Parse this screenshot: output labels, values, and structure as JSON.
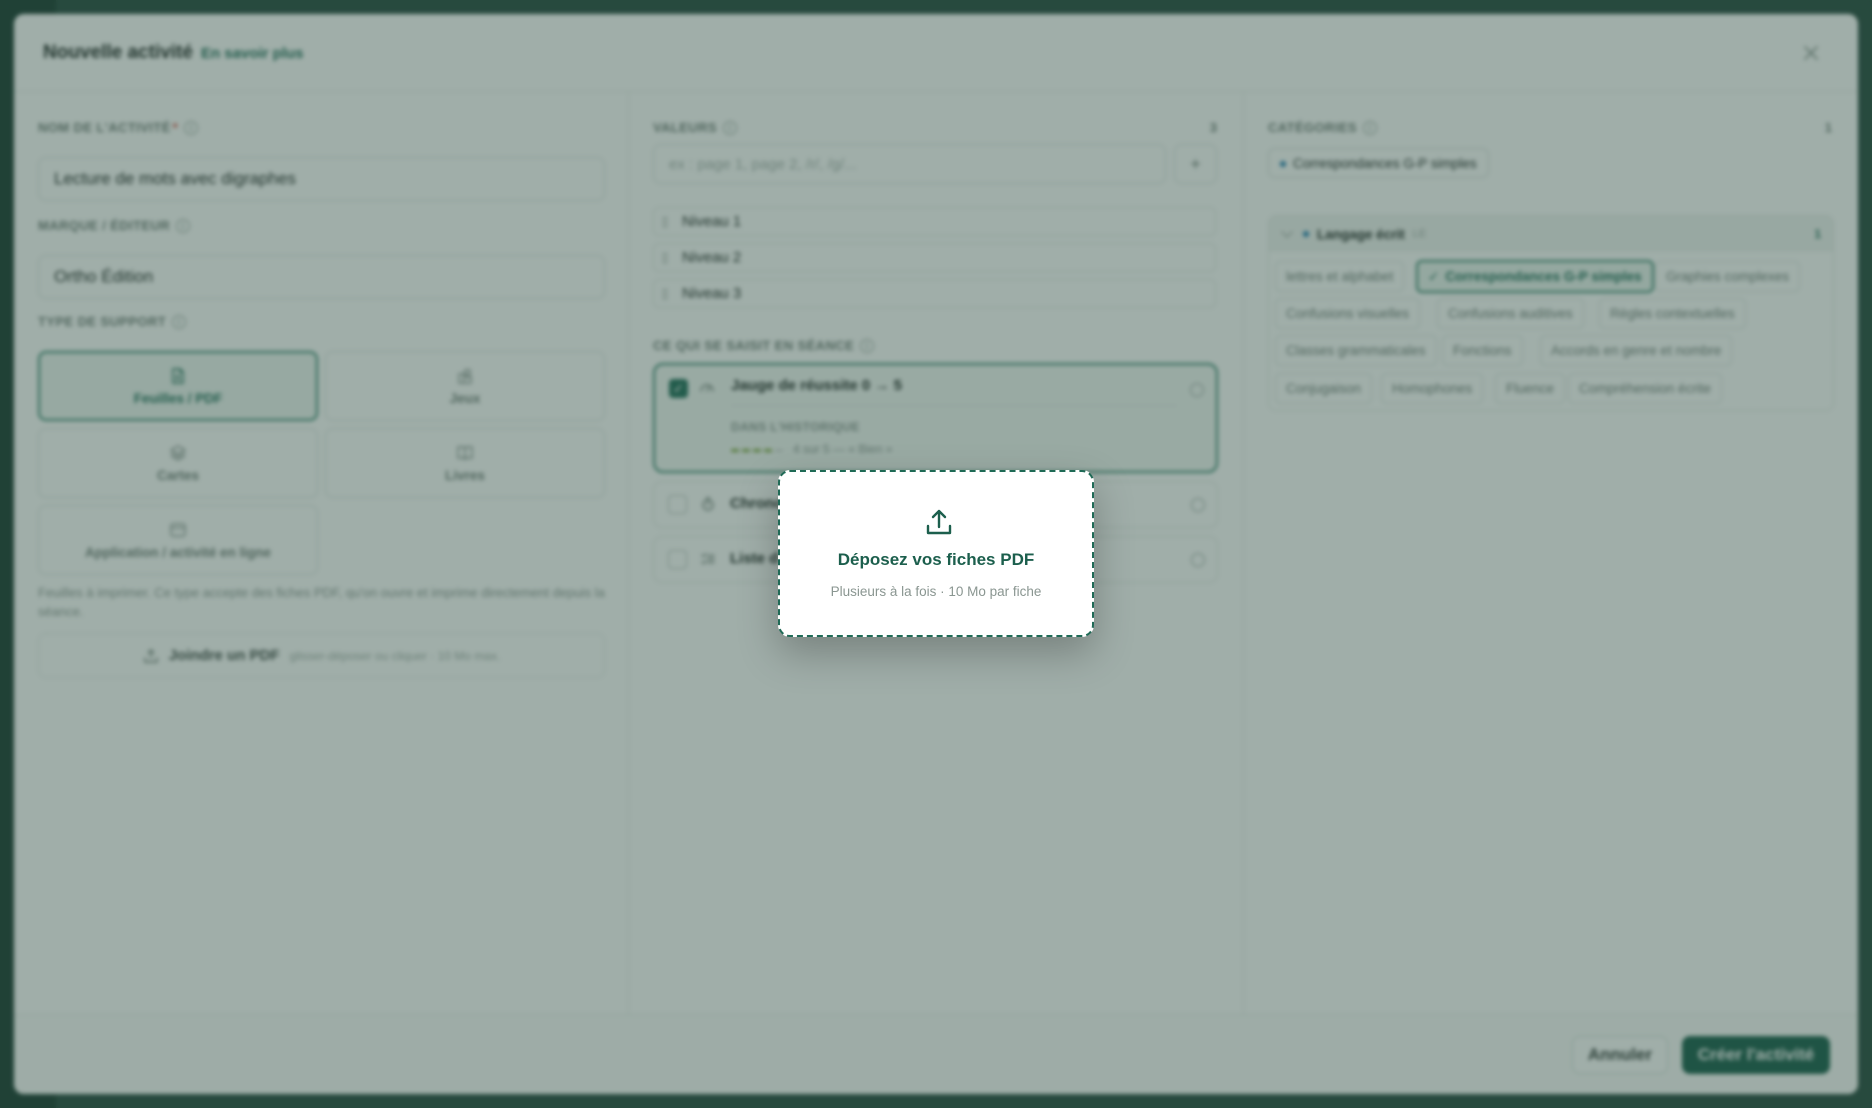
{
  "header": {
    "title": "Nouvelle activité",
    "learn_more": "En savoir plus"
  },
  "left": {
    "name_label": "NOM DE L'ACTIVITÉ",
    "name_required": "*",
    "name_value": "Lecture de mots avec digraphes",
    "brand_label": "MARQUE / ÉDITEUR",
    "brand_value": "Ortho Édition",
    "support_label": "TYPE DE SUPPORT",
    "supports": [
      {
        "label": "Feuilles / PDF",
        "icon": "file-icon",
        "active": true
      },
      {
        "label": "Jeux",
        "icon": "puzzle-icon",
        "active": false
      },
      {
        "label": "Cartes",
        "icon": "layers-icon",
        "active": false
      },
      {
        "label": "Livres",
        "icon": "book-icon",
        "active": false
      },
      {
        "label": "Application / activité en ligne",
        "icon": "browser-icon",
        "active": false
      }
    ],
    "description": "Feuilles à imprimer. Ce type accepte des fiches PDF, qu'on ouvre et imprime directement depuis la séance.",
    "join_pdf": "Joindre un PDF",
    "join_pdf_hint": "glisser-déposer ou cliquer · 10 Mo max."
  },
  "middle": {
    "values_label": "VALEURS",
    "values_count": "3",
    "values_placeholder": "ex : page 1, page 2, /r/, /g/...",
    "add_label": "+",
    "levels": [
      "Niveau 1",
      "Niveau 2",
      "Niveau 3"
    ],
    "session_label": "CE QUI SE SAISIT EN SÉANCE",
    "gauge": {
      "title": "Jauge de réussite 0 → 5",
      "history_label": "DANS L'HISTORIQUE",
      "history_value": "4 sur 5 — « Bien »",
      "level": 4,
      "max": 5
    },
    "options": [
      {
        "title": "Chrono",
        "icon": "stopwatch-icon"
      },
      {
        "title": "Liste d",
        "icon": "list-icon"
      }
    ]
  },
  "right": {
    "categories_label": "CATÉGORIES",
    "categories_count": "1",
    "selected": "Correspondances G-P simples",
    "group": {
      "name": "Langage écrit",
      "code": "LE",
      "count": "1"
    },
    "chips": [
      "lettres et alphabet",
      "Correspondances G-P simples",
      "Graphies complexes",
      "Confusions visuelles",
      "Confusions auditives",
      "Règles contextuelles",
      "Classes grammaticales",
      "Fonctions",
      "Accords en genre et nombre",
      "Conjugaison",
      "Homophones",
      "Fluence",
      "Compréhension écrite"
    ],
    "selected_chip_prefix": "✓"
  },
  "footer": {
    "cancel": "Annuler",
    "create": "Créer l'activité"
  },
  "drop_zone": {
    "title": "Déposez vos fiches PDF",
    "subtitle": "Plusieurs à la fois · 10 Mo par fiche",
    "icon": "upload-icon"
  },
  "colors": {
    "brand": "#155c49",
    "accent": "#2e8069",
    "gauge": "#7aa23a"
  }
}
